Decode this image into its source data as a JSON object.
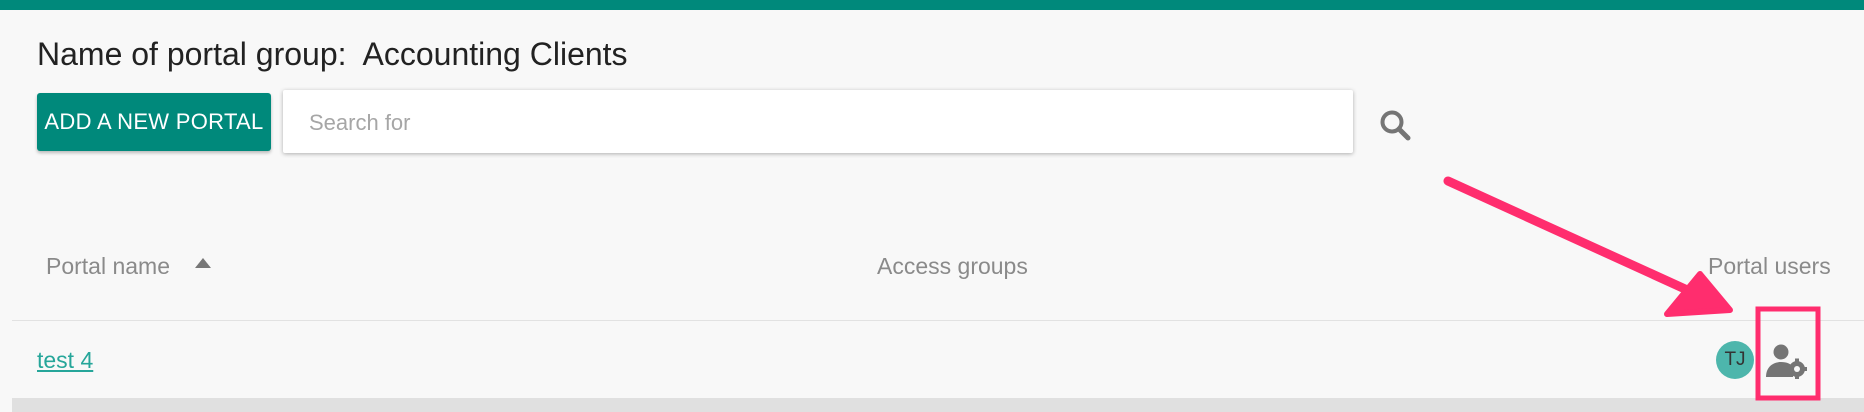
{
  "header": {
    "title": "Name of portal group:  Accounting Clients",
    "accent_color": "#00897b"
  },
  "toolbar": {
    "add_button_label": "ADD A NEW PORTAL",
    "search_placeholder": "Search for",
    "search_value": "",
    "search_icon": "search-icon"
  },
  "table": {
    "columns": [
      {
        "label": "Portal name",
        "sort": "ascending",
        "sort_icon": "sort-up-icon"
      },
      {
        "label": "Access groups"
      },
      {
        "label": "Portal users"
      }
    ],
    "rows": [
      {
        "portal_name": "test 4",
        "access_groups": "",
        "users": [
          {
            "initials": "TJ",
            "avatar_color": "#4db6ac"
          }
        ],
        "action_icon": "manage-users-icon"
      }
    ]
  },
  "annotation": {
    "arrow_color": "#ff2d6e",
    "highlight_color": "#ff2d6e"
  }
}
